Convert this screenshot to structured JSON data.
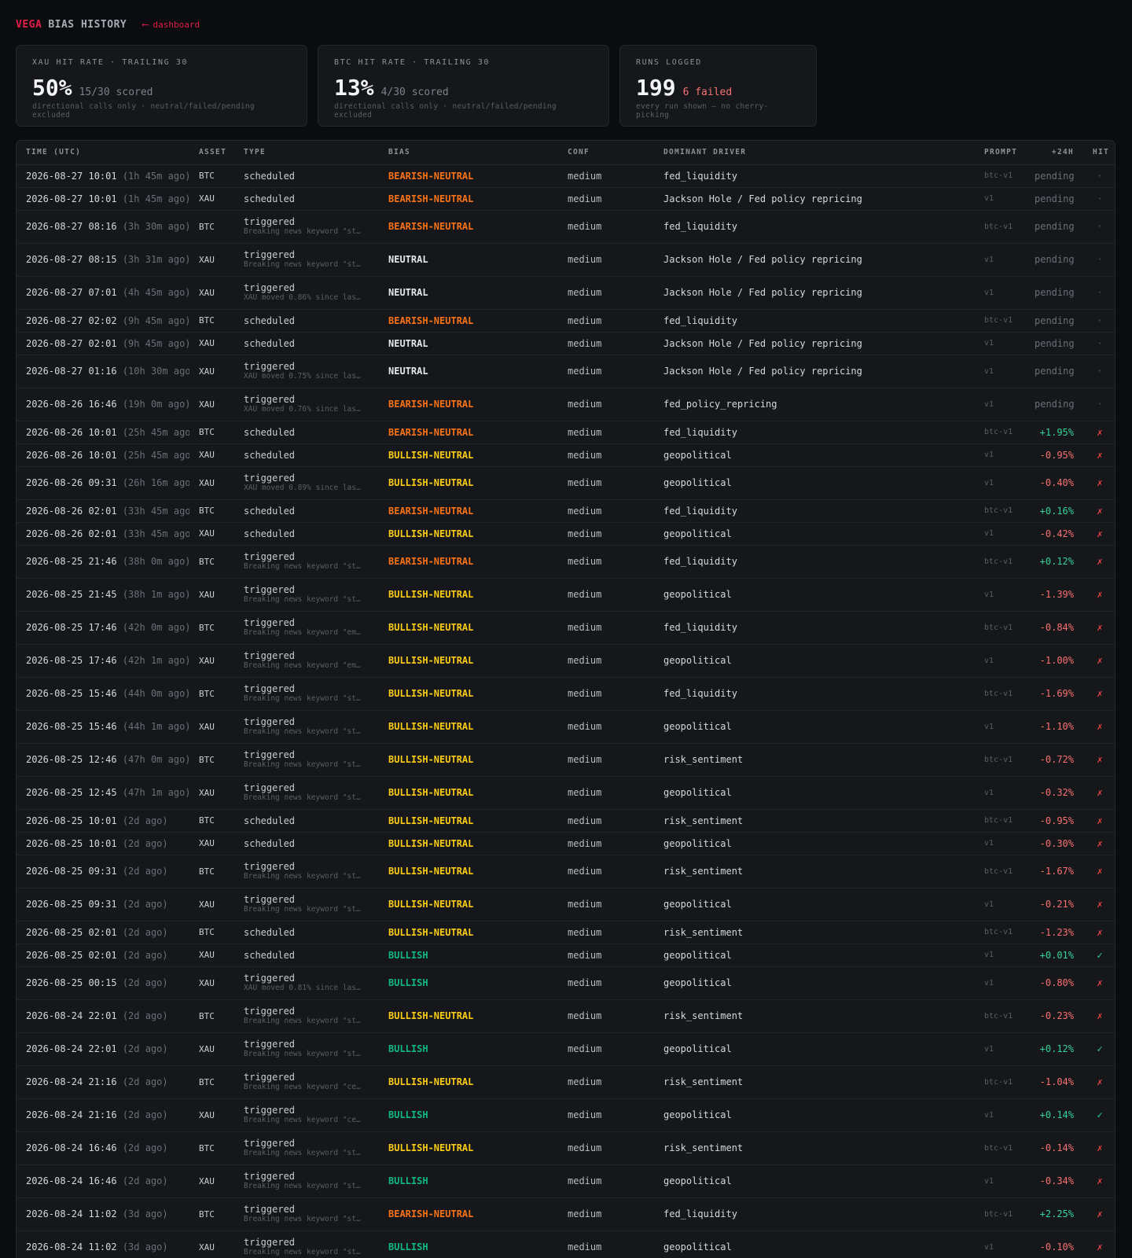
{
  "header": {
    "brand": "VEGA",
    "title": "BIAS HISTORY",
    "back_arrow": "⟵",
    "back_label": "dashboard"
  },
  "cards": [
    {
      "label": "XAU HIT RATE · TRAILING 30",
      "value": "50%",
      "sub": "15/30 scored",
      "foot": "directional calls only · neutral/failed/pending excluded"
    },
    {
      "label": "BTC HIT RATE · TRAILING 30",
      "value": "13%",
      "sub": "4/30 scored",
      "foot": "directional calls only · neutral/failed/pending excluded"
    },
    {
      "label": "RUNS LOGGED",
      "value": "199",
      "sub": "6 failed",
      "foot": "every run shown — no cherry-picking"
    }
  ],
  "table": {
    "headers": {
      "time": "TIME (UTC)",
      "asset": "ASSET",
      "type": "TYPE",
      "bias": "BIAS",
      "conf": "CONF",
      "driver": "DOMINANT DRIVER",
      "prompt": "PROMPT",
      "change": "+24H",
      "hit": "HIT"
    },
    "rows": [
      {
        "time": "2026-08-27 10:01",
        "ago": "(1h 45m ago)",
        "asset": "BTC",
        "type": "scheduled",
        "detail": "",
        "bias": "BEARISH-NEUTRAL",
        "conf": "medium",
        "driver": "fed_liquidity",
        "prompt": "btc-v1",
        "change": "pending",
        "hit": "·"
      },
      {
        "time": "2026-08-27 10:01",
        "ago": "(1h 45m ago)",
        "asset": "XAU",
        "type": "scheduled",
        "detail": "",
        "bias": "BEARISH-NEUTRAL",
        "conf": "medium",
        "driver": "Jackson Hole / Fed policy repricing",
        "prompt": "v1",
        "change": "pending",
        "hit": "·"
      },
      {
        "time": "2026-08-27 08:16",
        "ago": "(3h 30m ago)",
        "asset": "BTC",
        "type": "triggered",
        "detail": "Breaking news keyword \"st…",
        "bias": "BEARISH-NEUTRAL",
        "conf": "medium",
        "driver": "fed_liquidity",
        "prompt": "btc-v1",
        "change": "pending",
        "hit": "·"
      },
      {
        "time": "2026-08-27 08:15",
        "ago": "(3h 31m ago)",
        "asset": "XAU",
        "type": "triggered",
        "detail": "Breaking news keyword \"st…",
        "bias": "NEUTRAL",
        "conf": "medium",
        "driver": "Jackson Hole / Fed policy repricing",
        "prompt": "v1",
        "change": "pending",
        "hit": "·"
      },
      {
        "time": "2026-08-27 07:01",
        "ago": "(4h 45m ago)",
        "asset": "XAU",
        "type": "triggered",
        "detail": "XAU moved 0.86% since las…",
        "bias": "NEUTRAL",
        "conf": "medium",
        "driver": "Jackson Hole / Fed policy repricing",
        "prompt": "v1",
        "change": "pending",
        "hit": "·"
      },
      {
        "time": "2026-08-27 02:02",
        "ago": "(9h 45m ago)",
        "asset": "BTC",
        "type": "scheduled",
        "detail": "",
        "bias": "BEARISH-NEUTRAL",
        "conf": "medium",
        "driver": "fed_liquidity",
        "prompt": "btc-v1",
        "change": "pending",
        "hit": "·"
      },
      {
        "time": "2026-08-27 02:01",
        "ago": "(9h 45m ago)",
        "asset": "XAU",
        "type": "scheduled",
        "detail": "",
        "bias": "NEUTRAL",
        "conf": "medium",
        "driver": "Jackson Hole / Fed policy repricing",
        "prompt": "v1",
        "change": "pending",
        "hit": "·"
      },
      {
        "time": "2026-08-27 01:16",
        "ago": "(10h 30m ago)",
        "asset": "XAU",
        "type": "triggered",
        "detail": "XAU moved 0.75% since las…",
        "bias": "NEUTRAL",
        "conf": "medium",
        "driver": "Jackson Hole / Fed policy repricing",
        "prompt": "v1",
        "change": "pending",
        "hit": "·"
      },
      {
        "time": "2026-08-26 16:46",
        "ago": "(19h 0m ago)",
        "asset": "XAU",
        "type": "triggered",
        "detail": "XAU moved 0.76% since las…",
        "bias": "BEARISH-NEUTRAL",
        "conf": "medium",
        "driver": "fed_policy_repricing",
        "prompt": "v1",
        "change": "pending",
        "hit": "·"
      },
      {
        "time": "2026-08-26 10:01",
        "ago": "(25h 45m ago)",
        "asset": "BTC",
        "type": "scheduled",
        "detail": "",
        "bias": "BEARISH-NEUTRAL",
        "conf": "medium",
        "driver": "fed_liquidity",
        "prompt": "btc-v1",
        "change": "+1.95%",
        "hit": "✗"
      },
      {
        "time": "2026-08-26 10:01",
        "ago": "(25h 45m ago)",
        "asset": "XAU",
        "type": "scheduled",
        "detail": "",
        "bias": "BULLISH-NEUTRAL",
        "conf": "medium",
        "driver": "geopolitical",
        "prompt": "v1",
        "change": "-0.95%",
        "hit": "✗"
      },
      {
        "time": "2026-08-26 09:31",
        "ago": "(26h 16m ago)",
        "asset": "XAU",
        "type": "triggered",
        "detail": "XAU moved 0.89% since las…",
        "bias": "BULLISH-NEUTRAL",
        "conf": "medium",
        "driver": "geopolitical",
        "prompt": "v1",
        "change": "-0.40%",
        "hit": "✗"
      },
      {
        "time": "2026-08-26 02:01",
        "ago": "(33h 45m ago)",
        "asset": "BTC",
        "type": "scheduled",
        "detail": "",
        "bias": "BEARISH-NEUTRAL",
        "conf": "medium",
        "driver": "fed_liquidity",
        "prompt": "btc-v1",
        "change": "+0.16%",
        "hit": "✗"
      },
      {
        "time": "2026-08-26 02:01",
        "ago": "(33h 45m ago)",
        "asset": "XAU",
        "type": "scheduled",
        "detail": "",
        "bias": "BULLISH-NEUTRAL",
        "conf": "medium",
        "driver": "geopolitical",
        "prompt": "v1",
        "change": "-0.42%",
        "hit": "✗"
      },
      {
        "time": "2026-08-25 21:46",
        "ago": "(38h 0m ago)",
        "asset": "BTC",
        "type": "triggered",
        "detail": "Breaking news keyword \"st…",
        "bias": "BEARISH-NEUTRAL",
        "conf": "medium",
        "driver": "fed_liquidity",
        "prompt": "btc-v1",
        "change": "+0.12%",
        "hit": "✗"
      },
      {
        "time": "2026-08-25 21:45",
        "ago": "(38h 1m ago)",
        "asset": "XAU",
        "type": "triggered",
        "detail": "Breaking news keyword \"st…",
        "bias": "BULLISH-NEUTRAL",
        "conf": "medium",
        "driver": "geopolitical",
        "prompt": "v1",
        "change": "-1.39%",
        "hit": "✗"
      },
      {
        "time": "2026-08-25 17:46",
        "ago": "(42h 0m ago)",
        "asset": "BTC",
        "type": "triggered",
        "detail": "Breaking news keyword \"em…",
        "bias": "BULLISH-NEUTRAL",
        "conf": "medium",
        "driver": "fed_liquidity",
        "prompt": "btc-v1",
        "change": "-0.84%",
        "hit": "✗"
      },
      {
        "time": "2026-08-25 17:46",
        "ago": "(42h 1m ago)",
        "asset": "XAU",
        "type": "triggered",
        "detail": "Breaking news keyword \"em…",
        "bias": "BULLISH-NEUTRAL",
        "conf": "medium",
        "driver": "geopolitical",
        "prompt": "v1",
        "change": "-1.00%",
        "hit": "✗"
      },
      {
        "time": "2026-08-25 15:46",
        "ago": "(44h 0m ago)",
        "asset": "BTC",
        "type": "triggered",
        "detail": "Breaking news keyword \"st…",
        "bias": "BULLISH-NEUTRAL",
        "conf": "medium",
        "driver": "fed_liquidity",
        "prompt": "btc-v1",
        "change": "-1.69%",
        "hit": "✗"
      },
      {
        "time": "2026-08-25 15:46",
        "ago": "(44h 1m ago)",
        "asset": "XAU",
        "type": "triggered",
        "detail": "Breaking news keyword \"st…",
        "bias": "BULLISH-NEUTRAL",
        "conf": "medium",
        "driver": "geopolitical",
        "prompt": "v1",
        "change": "-1.10%",
        "hit": "✗"
      },
      {
        "time": "2026-08-25 12:46",
        "ago": "(47h 0m ago)",
        "asset": "BTC",
        "type": "triggered",
        "detail": "Breaking news keyword \"st…",
        "bias": "BULLISH-NEUTRAL",
        "conf": "medium",
        "driver": "risk_sentiment",
        "prompt": "btc-v1",
        "change": "-0.72%",
        "hit": "✗"
      },
      {
        "time": "2026-08-25 12:45",
        "ago": "(47h 1m ago)",
        "asset": "XAU",
        "type": "triggered",
        "detail": "Breaking news keyword \"st…",
        "bias": "BULLISH-NEUTRAL",
        "conf": "medium",
        "driver": "geopolitical",
        "prompt": "v1",
        "change": "-0.32%",
        "hit": "✗"
      },
      {
        "time": "2026-08-25 10:01",
        "ago": "(2d ago)",
        "asset": "BTC",
        "type": "scheduled",
        "detail": "",
        "bias": "BULLISH-NEUTRAL",
        "conf": "medium",
        "driver": "risk_sentiment",
        "prompt": "btc-v1",
        "change": "-0.95%",
        "hit": "✗"
      },
      {
        "time": "2026-08-25 10:01",
        "ago": "(2d ago)",
        "asset": "XAU",
        "type": "scheduled",
        "detail": "",
        "bias": "BULLISH-NEUTRAL",
        "conf": "medium",
        "driver": "geopolitical",
        "prompt": "v1",
        "change": "-0.30%",
        "hit": "✗"
      },
      {
        "time": "2026-08-25 09:31",
        "ago": "(2d ago)",
        "asset": "BTC",
        "type": "triggered",
        "detail": "Breaking news keyword \"st…",
        "bias": "BULLISH-NEUTRAL",
        "conf": "medium",
        "driver": "risk_sentiment",
        "prompt": "btc-v1",
        "change": "-1.67%",
        "hit": "✗"
      },
      {
        "time": "2026-08-25 09:31",
        "ago": "(2d ago)",
        "asset": "XAU",
        "type": "triggered",
        "detail": "Breaking news keyword \"st…",
        "bias": "BULLISH-NEUTRAL",
        "conf": "medium",
        "driver": "geopolitical",
        "prompt": "v1",
        "change": "-0.21%",
        "hit": "✗"
      },
      {
        "time": "2026-08-25 02:01",
        "ago": "(2d ago)",
        "asset": "BTC",
        "type": "scheduled",
        "detail": "",
        "bias": "BULLISH-NEUTRAL",
        "conf": "medium",
        "driver": "risk_sentiment",
        "prompt": "btc-v1",
        "change": "-1.23%",
        "hit": "✗"
      },
      {
        "time": "2026-08-25 02:01",
        "ago": "(2d ago)",
        "asset": "XAU",
        "type": "scheduled",
        "detail": "",
        "bias": "BULLISH",
        "conf": "medium",
        "driver": "geopolitical",
        "prompt": "v1",
        "change": "+0.01%",
        "hit": "✓"
      },
      {
        "time": "2026-08-25 00:15",
        "ago": "(2d ago)",
        "asset": "XAU",
        "type": "triggered",
        "detail": "XAU moved 0.81% since las…",
        "bias": "BULLISH",
        "conf": "medium",
        "driver": "geopolitical",
        "prompt": "v1",
        "change": "-0.80%",
        "hit": "✗"
      },
      {
        "time": "2026-08-24 22:01",
        "ago": "(2d ago)",
        "asset": "BTC",
        "type": "triggered",
        "detail": "Breaking news keyword \"st…",
        "bias": "BULLISH-NEUTRAL",
        "conf": "medium",
        "driver": "risk_sentiment",
        "prompt": "btc-v1",
        "change": "-0.23%",
        "hit": "✗"
      },
      {
        "time": "2026-08-24 22:01",
        "ago": "(2d ago)",
        "asset": "XAU",
        "type": "triggered",
        "detail": "Breaking news keyword \"st…",
        "bias": "BULLISH",
        "conf": "medium",
        "driver": "geopolitical",
        "prompt": "v1",
        "change": "+0.12%",
        "hit": "✓"
      },
      {
        "time": "2026-08-24 21:16",
        "ago": "(2d ago)",
        "asset": "BTC",
        "type": "triggered",
        "detail": "Breaking news keyword \"ce…",
        "bias": "BULLISH-NEUTRAL",
        "conf": "medium",
        "driver": "risk_sentiment",
        "prompt": "btc-v1",
        "change": "-1.04%",
        "hit": "✗"
      },
      {
        "time": "2026-08-24 21:16",
        "ago": "(2d ago)",
        "asset": "XAU",
        "type": "triggered",
        "detail": "Breaking news keyword \"ce…",
        "bias": "BULLISH",
        "conf": "medium",
        "driver": "geopolitical",
        "prompt": "v1",
        "change": "+0.14%",
        "hit": "✓"
      },
      {
        "time": "2026-08-24 16:46",
        "ago": "(2d ago)",
        "asset": "BTC",
        "type": "triggered",
        "detail": "Breaking news keyword \"st…",
        "bias": "BULLISH-NEUTRAL",
        "conf": "medium",
        "driver": "risk_sentiment",
        "prompt": "btc-v1",
        "change": "-0.14%",
        "hit": "✗"
      },
      {
        "time": "2026-08-24 16:46",
        "ago": "(2d ago)",
        "asset": "XAU",
        "type": "triggered",
        "detail": "Breaking news keyword \"st…",
        "bias": "BULLISH",
        "conf": "medium",
        "driver": "geopolitical",
        "prompt": "v1",
        "change": "-0.34%",
        "hit": "✗"
      },
      {
        "time": "2026-08-24 11:02",
        "ago": "(3d ago)",
        "asset": "BTC",
        "type": "triggered",
        "detail": "Breaking news keyword \"st…",
        "bias": "BEARISH-NEUTRAL",
        "conf": "medium",
        "driver": "fed_liquidity",
        "prompt": "btc-v1",
        "change": "+2.25%",
        "hit": "✗"
      },
      {
        "time": "2026-08-24 11:02",
        "ago": "(3d ago)",
        "asset": "XAU",
        "type": "triggered",
        "detail": "Breaking news keyword \"st…",
        "bias": "BULLISH",
        "conf": "medium",
        "driver": "geopolitical",
        "prompt": "v1",
        "change": "-0.10%",
        "hit": "✗"
      }
    ]
  }
}
